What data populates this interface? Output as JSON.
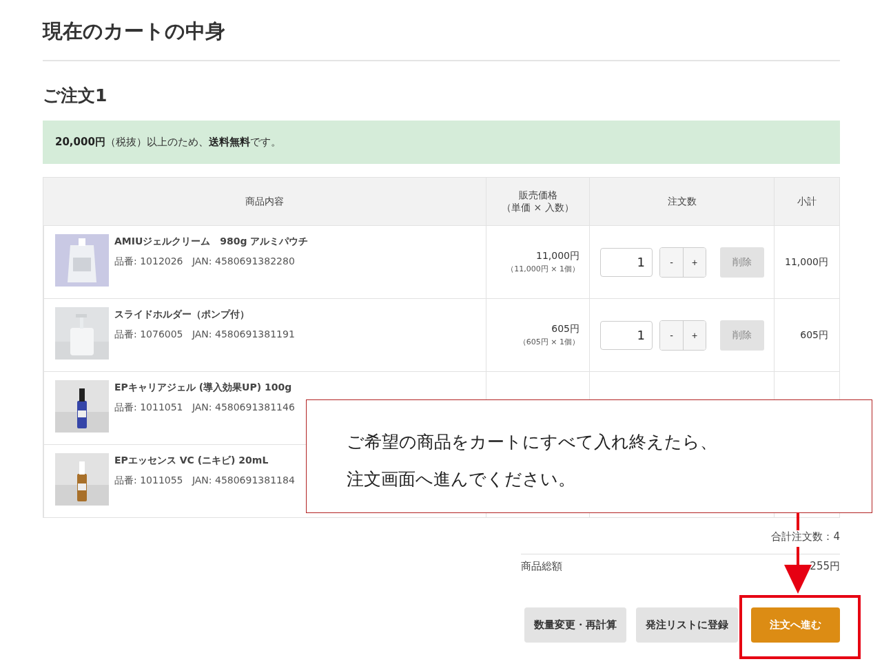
{
  "page": {
    "title": "現在のカートの中身"
  },
  "order": {
    "heading": "ご注文1",
    "notice": "**20,000円**（税抜）以上のため、**送料無料**です。"
  },
  "table": {
    "columns": [
      {
        "lines": [
          "商品内容"
        ]
      },
      {
        "lines": [
          "販売価格",
          "（単価 × 入数）"
        ]
      },
      {
        "lines": [
          "注文数"
        ]
      },
      {
        "lines": [
          "小計"
        ]
      }
    ],
    "rows": [
      {
        "name": "AMIUジェルクリーム　980g アルミパウチ",
        "code": "品番: 1012026",
        "jan": "JAN: 4580691382280",
        "price": "11,000円",
        "breakdown": "（11,000円 × 1個）",
        "quantity": "1",
        "minus": "-",
        "plus": "+",
        "delete": "削除",
        "subtotal": "11,000円"
      },
      {
        "name": "スライドホルダー（ポンプ付）",
        "code": "品番: 1076005",
        "jan": "JAN: 4580691381191",
        "price": "605円",
        "breakdown": "（605円 × 1個）",
        "quantity": "1",
        "minus": "-",
        "plus": "+",
        "delete": "削除",
        "subtotal": "605円"
      },
      {
        "name": "EPキャリアジェル (導入効果UP) 100g",
        "code": "品番: 1011051",
        "jan": "JAN: 4580691381146"
      },
      {
        "name": "EPエッセンス VC (ニキビ) 20mL",
        "code": "品番: 1011055",
        "jan": "JAN: 4580691381184"
      }
    ]
  },
  "summary": {
    "total_quantity": "合計注文数：4",
    "total_label": "商品総額",
    "total_value": "255円"
  },
  "buttons": [
    {
      "label": "数量変更・再計算",
      "kind": "secondary"
    },
    {
      "label": "発注リストに登録",
      "kind": "secondary"
    },
    {
      "label": "注文へ進む",
      "kind": "primary"
    }
  ],
  "callout": {
    "lines": [
      "ご希望の商品をカートにすべて入れ終えたら、",
      "注文画面へ進んでください。"
    ]
  }
}
